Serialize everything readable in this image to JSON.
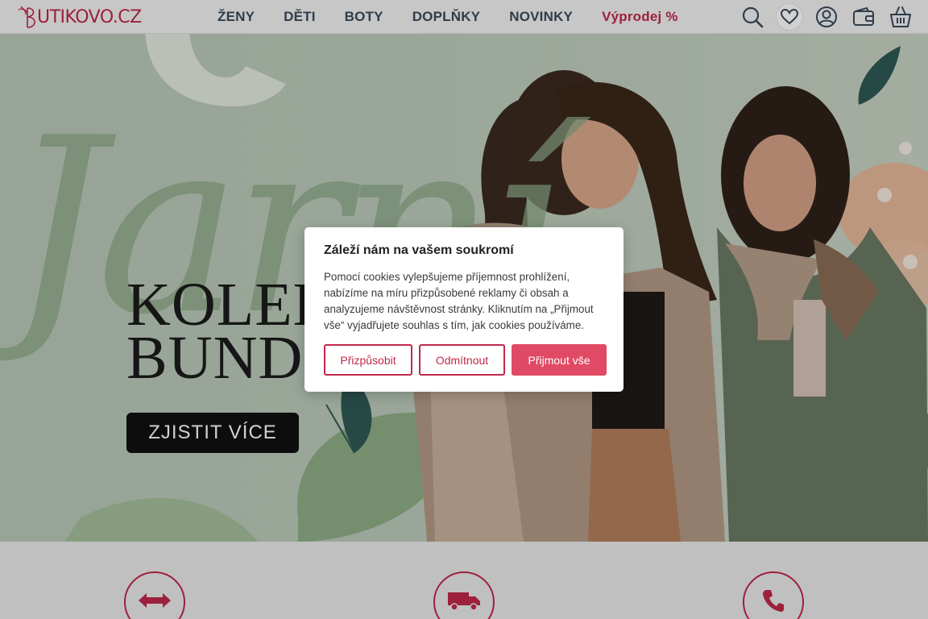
{
  "header": {
    "logo_text": "UTIKOVO.CZ",
    "logo_letter": "B",
    "nav": [
      {
        "label": "ŽENY"
      },
      {
        "label": "DĚTI"
      },
      {
        "label": "BOTY"
      },
      {
        "label": "DOPLŇKY"
      },
      {
        "label": "NOVINKY"
      },
      {
        "label": "Výprodej %"
      }
    ],
    "icons": [
      "search-icon",
      "heart-icon",
      "user-icon",
      "wallet-icon",
      "basket-icon"
    ]
  },
  "hero": {
    "script_text": "Jarní",
    "title_line1": "KOLEK",
    "title_line2": "BUND",
    "cta_label": "ZJISTIT VÍCE"
  },
  "features": {
    "icons": [
      "exchange-arrows-icon",
      "delivery-truck-icon",
      "phone-icon"
    ]
  },
  "cookie_dialog": {
    "title": "Záleží nám na vašem soukromí",
    "text": "Pomocí cookies vylepšujeme příjemnost prohlížení, nabízíme na míru přizpůsobené reklamy či obsah a analyzujeme návštěvnost stránky. Kliknutím na „Přijmout vše“ vyjadřujete souhlas s tím, jak cookies používáme.",
    "btn_customize": "Přizpůsobit",
    "btn_reject": "Odmítnout",
    "btn_accept": "Přijmout vše"
  },
  "colors": {
    "brand": "#c0284a",
    "accept": "#e04a64",
    "nav_text": "#3a4a5c",
    "hero_bg": "#bccbbb"
  }
}
